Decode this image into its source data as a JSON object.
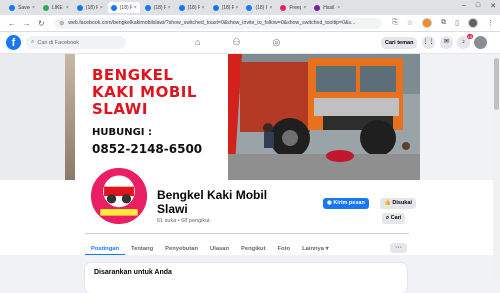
{
  "browser": {
    "tabs": [
      {
        "label": "Saved",
        "color": "#1877f2",
        "active": false
      },
      {
        "label": "LIKE K",
        "color": "#34a853",
        "active": false
      },
      {
        "label": "(18) Fa",
        "color": "#1877f2",
        "active": false
      },
      {
        "label": "(18) Fa",
        "color": "#1877f2",
        "active": true
      },
      {
        "label": "(18) Fa",
        "color": "#1877f2",
        "active": false
      },
      {
        "label": "(18) Fa",
        "color": "#1877f2",
        "active": false
      },
      {
        "label": "(18) Fa",
        "color": "#1877f2",
        "active": false
      },
      {
        "label": "(18) Fa",
        "color": "#1877f2",
        "active": false
      },
      {
        "label": "Freepik",
        "color": "#e91e63",
        "active": false
      },
      {
        "label": "Hasil",
        "color": "#7b1fa2",
        "active": false
      }
    ],
    "url": "web.facebook.com/bengkelkakimobilslawi/?show_switched_toast=0&show_invite_to_follow=0&show_switched_tooltip=0&s..."
  },
  "facebook": {
    "search_placeholder": "Cari di Facebook",
    "find_friends": "Cari teman",
    "notification_count": "18"
  },
  "cover": {
    "title_lines": [
      "BENGKEL",
      "KAKI MOBIL",
      "SLAWI"
    ],
    "contact_label": "HUBUNGI :",
    "phone": "0852-2148-6500"
  },
  "page": {
    "name": "Bengkel Kaki Mobil Slawi",
    "stats": "61 suka • 68 pengikut",
    "message_button": "Kirim pesan",
    "like_button": "Disukai",
    "search_button": "Cari",
    "more_button": "···"
  },
  "tabs": [
    "Postingan",
    "Tentang",
    "Penyebutan",
    "Ulasan",
    "Pengikut",
    "Foto",
    "Lainnya"
  ],
  "active_tab": "Postingan",
  "suggestions": {
    "title": "Disarankan untuk Anda"
  },
  "colors": {
    "facebook_blue": "#1877f2",
    "cover_red": "#e0141c"
  }
}
